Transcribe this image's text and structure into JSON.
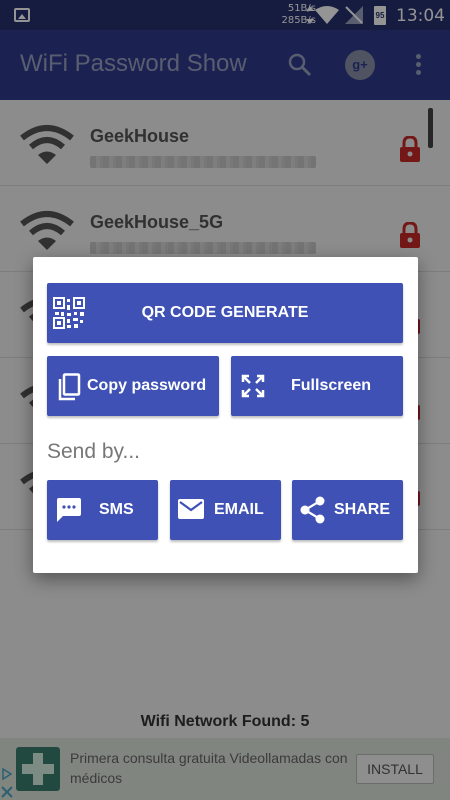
{
  "status_bar": {
    "upload_speed": "51B/s",
    "download_speed": "285B/s",
    "battery": "95",
    "time": "13:04"
  },
  "app_bar": {
    "title": "WiFi Password Show",
    "icons": [
      "search-icon",
      "google-plus-icon",
      "more-vert-icon"
    ],
    "gplus_label": "g+"
  },
  "networks": [
    {
      "ssid": "GeekHouse"
    },
    {
      "ssid": "GeekHouse_5G"
    },
    {
      "ssid": ""
    },
    {
      "ssid": ""
    },
    {
      "ssid": ""
    }
  ],
  "footer": {
    "found_text": "Wifi Network Found: 5"
  },
  "ad": {
    "text": "Primera consulta gratuita Videollamadas con médicos",
    "install_label": "INSTALL"
  },
  "dialog": {
    "qr_label": "QR CODE GENERATE",
    "copy_label": "Copy password",
    "fullscreen_label": "Fullscreen",
    "send_by_label": "Send by...",
    "sms_label": "SMS",
    "email_label": "EMAIL",
    "share_label": "SHARE"
  },
  "colors": {
    "primary": "#2f3b8c",
    "status_bar": "#26306f",
    "button": "#3f51b5",
    "lock": "#c62828"
  }
}
